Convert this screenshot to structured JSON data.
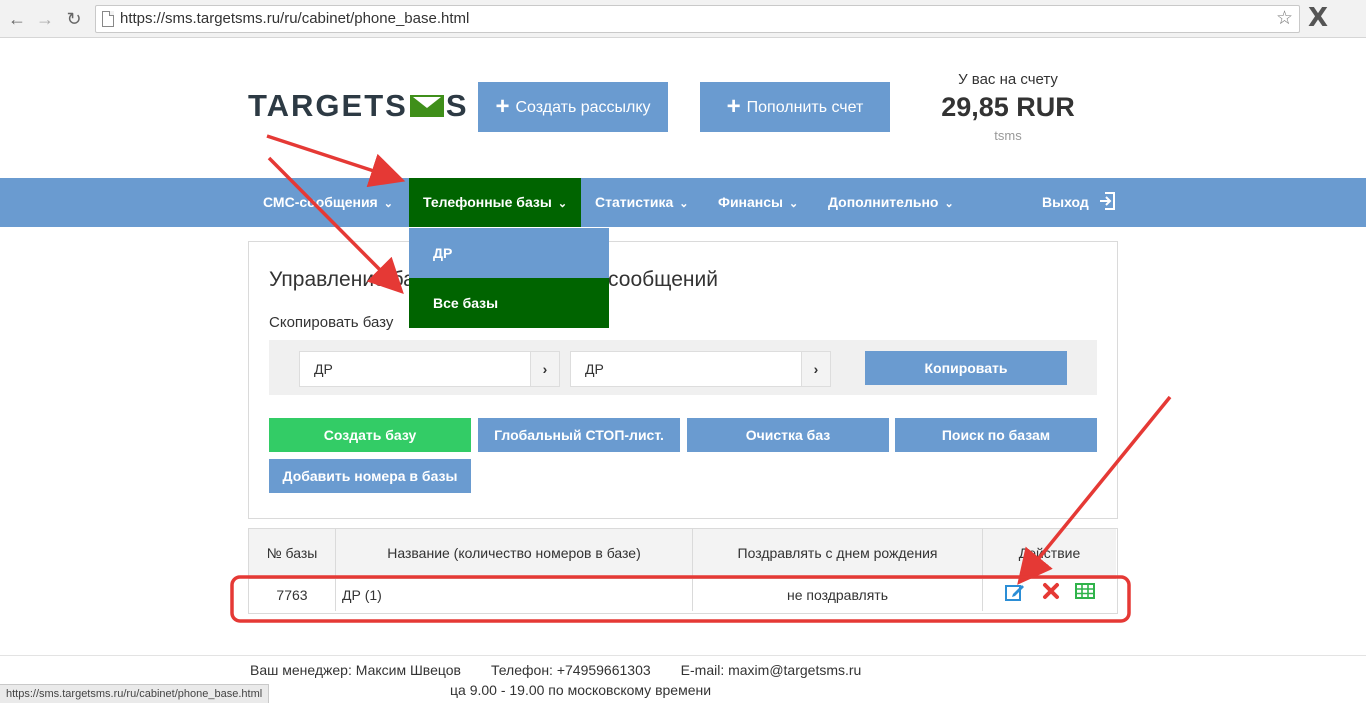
{
  "browser": {
    "url": "https://sms.targetsms.ru/ru/cabinet/phone_base.html",
    "status_url": "https://sms.targetsms.ru/ru/cabinet/phone_base.html"
  },
  "header": {
    "logo_left": "TARGETS",
    "logo_right": "S",
    "create_mailing": "Создать рассылку",
    "top_up": "Пополнить счет",
    "balance_label": "У вас на счету",
    "balance_value": "29,85 RUR",
    "balance_unit": "tsms"
  },
  "nav": {
    "items": [
      "СМС-сообщения",
      "Телефонные базы",
      "Статистика",
      "Финансы",
      "Дополнительно"
    ],
    "logout": "Выход",
    "dropdown": [
      "ДР",
      "Все базы"
    ]
  },
  "panel": {
    "title": "Управление базами для рассылки сообщений",
    "copy_label": "Скопировать базу",
    "from_base": "ДР",
    "to_base": "ДР",
    "copy_button": "Копировать",
    "create_base": "Создать базу",
    "global_stop": "Глобальный СТОП-лист.",
    "clean_bases": "Очистка баз",
    "search_bases": "Поиск по базам",
    "add_numbers": "Добавить номера в базы"
  },
  "table": {
    "columns": [
      "№ базы",
      "Название (количество номеров в базе)",
      "Поздравлять с днем рождения",
      "Действие"
    ],
    "rows": [
      {
        "id": "7763",
        "name": "ДР (1)",
        "birthday": "не поздравлять"
      }
    ]
  },
  "footer": {
    "manager": "Ваш менеджер: Максим Швецов",
    "phone": "Телефон: +74959661303",
    "email": "E-mail: maxim@targetsms.ru",
    "hours": "ца 9.00 - 19.00 по московскому времени"
  },
  "colors": {
    "nav_blue": "#6a9bd0",
    "active_green": "#006400",
    "create_green": "#33cc66",
    "annotation_red": "#e53935"
  },
  "icons": [
    "back-arrow-icon",
    "forward-arrow-icon",
    "reload-icon",
    "page-icon",
    "bookmark-star-icon",
    "extension-x-icon",
    "plus-icon",
    "chevron-down-icon",
    "logout-icon",
    "chevron-right-icon",
    "edit-icon",
    "delete-icon",
    "table-icon"
  ]
}
